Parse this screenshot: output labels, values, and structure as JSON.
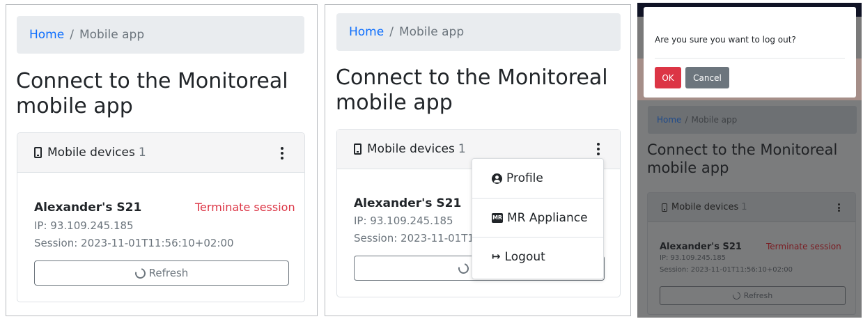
{
  "breadcrumb": {
    "home": "Home",
    "separator": "/",
    "current": "Mobile app"
  },
  "page_title_line1": "Connect to the Monitoreal",
  "page_title_line2": "mobile app",
  "devices_card": {
    "header_label": "Mobile devices",
    "count": "1",
    "device": {
      "name": "Alexander's S21",
      "terminate_label": "Terminate session",
      "ip": "IP: 93.109.245.185",
      "session": "Session: 2023-11-01T11:56:10+02:00",
      "session_truncated": "Session: 2023-11-01T11"
    },
    "refresh_label": "Refresh",
    "refresh_truncated": "R"
  },
  "dropdown_menu": [
    {
      "label": "Profile",
      "icon": "user-circle-icon"
    },
    {
      "label": "MR Appliance",
      "icon": "mr-appliance-icon",
      "icon_text": "MR"
    },
    {
      "label": "Logout",
      "icon": "sign-out-icon"
    }
  ],
  "logout_modal": {
    "question": "Are you sure you want to log out?",
    "ok_label": "OK",
    "cancel_label": "Cancel"
  },
  "colors": {
    "link": "#0d6efd",
    "danger": "#dc3545",
    "secondary": "#6c757d",
    "breadcrumb_bg": "#e9ecef"
  }
}
